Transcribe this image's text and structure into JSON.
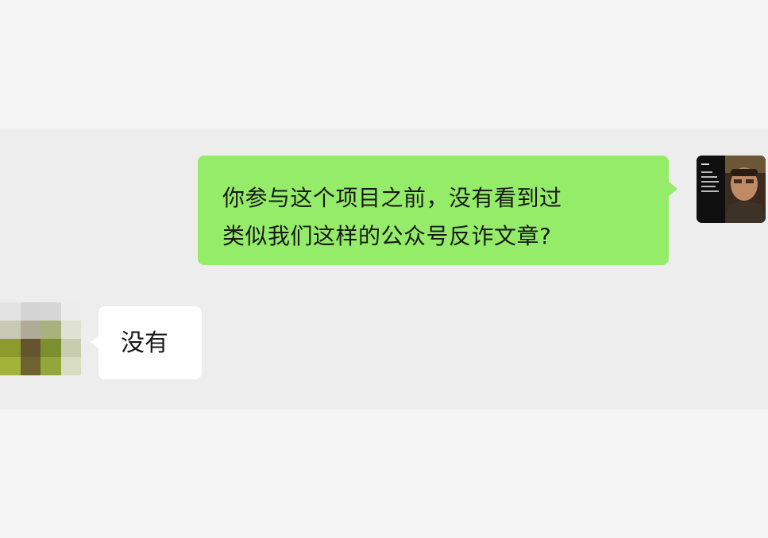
{
  "chat": {
    "messages": [
      {
        "direction": "outgoing",
        "text": "你参与这个项目之前，没有看到过\n类似我们这样的公众号反诈文章?",
        "bubble_color": "#95ec69"
      },
      {
        "direction": "incoming",
        "text": "没有",
        "bubble_color": "#ffffff"
      }
    ]
  },
  "colors": {
    "page_background": "#f5f5f5",
    "chat_band": "#ededed",
    "text": "#191919"
  },
  "icons": {
    "self_avatar": "photo-avatar-icon",
    "peer_avatar": "pixelated-avatar-icon"
  }
}
